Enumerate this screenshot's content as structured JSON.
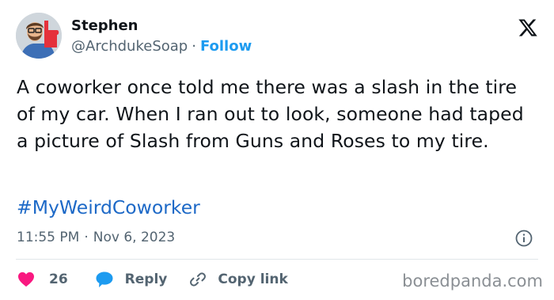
{
  "author": {
    "name": "Stephen",
    "handle": "@ArchdukeSoap",
    "separator": "·",
    "follow_label": "Follow"
  },
  "tweet": {
    "text": "A coworker once told me there was a slash in the tire of my car. When I ran out to look, someone had taped a picture of Slash from Guns and Roses to my tire.",
    "hashtag": "#MyWeirdCoworker",
    "time": "11:55 PM",
    "separator": "·",
    "date": "Nov 6, 2023"
  },
  "actions": {
    "like_count": "26",
    "reply_label": "Reply",
    "copy_link_label": "Copy link"
  },
  "icons": {
    "avatar": "foam-finger-avatar",
    "logo": "x-logo-icon",
    "info": "info-icon",
    "like": "heart-icon",
    "reply": "speech-bubble-icon",
    "copy": "link-icon"
  },
  "colors": {
    "link": "#1d9bf0",
    "hashtag": "#1d69c7",
    "heart": "#f91880",
    "reply": "#1d9bf0",
    "secondary_text": "#536471"
  },
  "watermark": "boredpanda.com"
}
